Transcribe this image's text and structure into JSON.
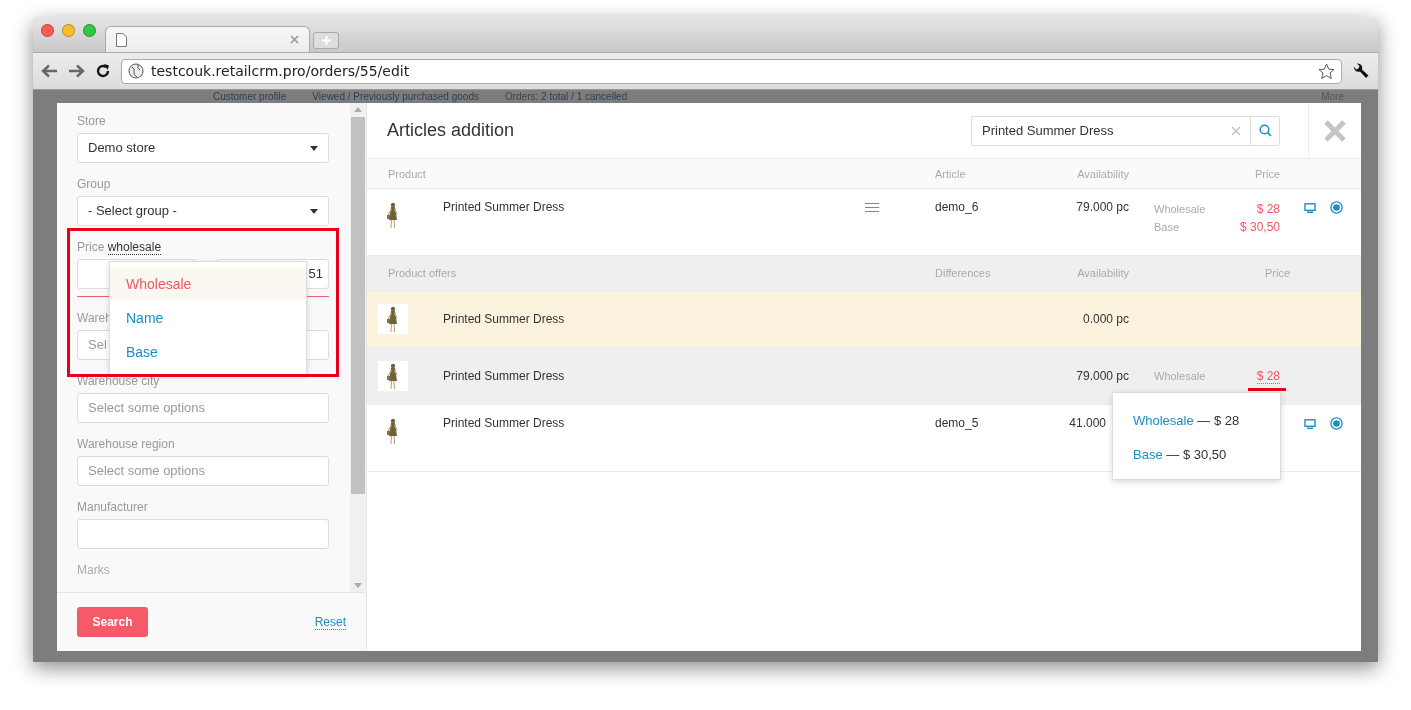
{
  "browser": {
    "url": "testcouk.retailcrm.pro/orders/55/edit"
  },
  "page_behind": {
    "links": [
      "Customer profile",
      "Viewed / Previously purchased goods"
    ],
    "orders_label": "Orders:",
    "orders_value": "2 total / 1 cancelled",
    "more": "More"
  },
  "filters": {
    "fields": [
      {
        "kind": "select",
        "label": "Store",
        "value": "Demo store"
      },
      {
        "kind": "select",
        "label": "Group",
        "value": "- Select group -"
      },
      {
        "kind": "range",
        "label": "Price",
        "label_link": "wholesale",
        "to_value": "51"
      },
      {
        "kind": "multiselect",
        "label": "Wareh",
        "placeholder": "Sel"
      },
      {
        "kind": "multiselect",
        "label": "Warehouse city",
        "placeholder": "Select some options"
      },
      {
        "kind": "multiselect",
        "label": "Warehouse region",
        "placeholder": "Select some options"
      },
      {
        "kind": "text",
        "label": "Manufacturer"
      },
      {
        "kind": "faded",
        "label": "Marks"
      }
    ],
    "price_menu": [
      {
        "label": "Wholesale",
        "selected": true
      },
      {
        "label": "Name",
        "selected": false
      },
      {
        "label": "Base",
        "selected": false
      }
    ],
    "search_button": "Search",
    "reset_link": "Reset"
  },
  "articles": {
    "title": "Articles addition",
    "search": {
      "value": "Printed Summer Dress"
    },
    "columns": [
      "Product",
      "Article",
      "Availability",
      "Price"
    ],
    "rows": [
      {
        "kind": "product",
        "name": "Printed Summer Dress",
        "article": "demo_6",
        "availability": "79.000 pc",
        "prices": [
          {
            "label": "Wholesale",
            "value": "$ 28"
          },
          {
            "label": "Base",
            "value": "$ 30,50"
          }
        ],
        "expanded": true,
        "highlighted": false,
        "checked": true
      },
      {
        "kind": "offers-header",
        "columns": [
          "Product offers",
          "Differences",
          "Availability",
          "Price"
        ]
      },
      {
        "kind": "offer",
        "name": "Printed Summer Dress",
        "availability": "0.000 pc",
        "highlighted": true
      },
      {
        "kind": "offer",
        "name": "Printed Summer Dress",
        "availability": "79.000 pc",
        "prices": [
          {
            "label": "Wholesale",
            "value": "$ 28"
          }
        ],
        "highlighted": false,
        "popover": [
          {
            "label": "Wholesale",
            "value": "— $ 28"
          },
          {
            "label": "Base",
            "value": "— $ 30,50"
          }
        ]
      },
      {
        "kind": "product",
        "name": "Printed Summer Dress",
        "article": "demo_5",
        "availability": "41.000",
        "expanded": false,
        "highlighted": false,
        "checked": true
      }
    ]
  }
}
